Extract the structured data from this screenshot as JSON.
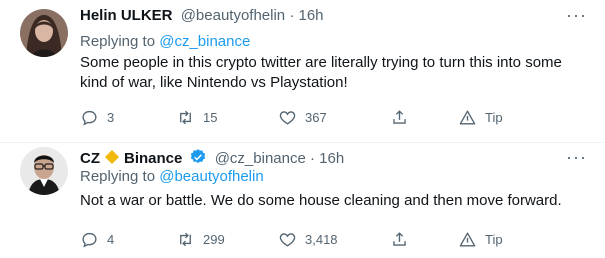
{
  "tweets": [
    {
      "name": "Helin ULKER",
      "handle": "@beautyofhelin",
      "time": "16h",
      "replying_prefix": "Replying to",
      "replying_to": "@cz_binance",
      "text": "Some people in this crypto twitter are literally trying to turn this into some kind of war, like Nintendo vs Playstation!",
      "replies": "3",
      "retweets": "15",
      "likes": "367",
      "tip": "Tip"
    },
    {
      "name_first": "CZ",
      "name_last": "Binance",
      "handle": "@cz_binance",
      "time": "16h",
      "replying_prefix": "Replying to",
      "replying_to": "@beautyofhelin",
      "text": "Not a war or battle. We do some house cleaning and then move forward.",
      "replies": "4",
      "retweets": "299",
      "likes": "3,418",
      "tip": "Tip"
    }
  ],
  "more_glyph": "···",
  "separator": "·",
  "icons": [
    "more-icon",
    "reply-icon",
    "retweet-icon",
    "like-icon",
    "share-icon",
    "tip-icon",
    "verified-icon",
    "binance-diamond-icon"
  ],
  "colors": {
    "accent": "#1d9bf0",
    "muted": "#536471",
    "binance": "#f0b90b"
  }
}
